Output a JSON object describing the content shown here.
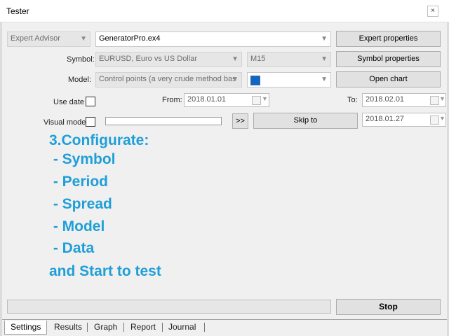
{
  "window": {
    "title": "Tester",
    "close_glyph": "×"
  },
  "expert": {
    "type_value": "Expert Advisor",
    "file_value": "GeneratorPro.ex4",
    "properties_label": "Expert properties"
  },
  "symbol": {
    "label": "Symbol:",
    "value": "EURUSD, Euro vs US Dollar",
    "period_value": "M15",
    "properties_label": "Symbol properties"
  },
  "model": {
    "label": "Model:",
    "value": "Control points (a very crude method bas",
    "spread_value": "",
    "open_chart_label": "Open chart"
  },
  "use_date": {
    "label": "Use date",
    "checked": false,
    "from_label": "From:",
    "from_value": "2018.01.01",
    "to_label": "To:",
    "to_value": "2018.02.01"
  },
  "visual_mode": {
    "label": "Visual mode",
    "checked": false,
    "forward_label": ">>",
    "skip_label": "Skip to",
    "skip_value": "2018.01.27"
  },
  "annotation": {
    "lines": [
      "3.Configurate:",
      " - Symbol",
      " - Period",
      " - Spread",
      " - Model",
      " - Data",
      "and Start to test"
    ],
    "color": "#1f9fd8"
  },
  "actions": {
    "stop_label": "Stop",
    "progress": 0
  },
  "tabs": [
    "Settings",
    "Results",
    "Graph",
    "Report",
    "Journal"
  ],
  "active_tab": "Settings",
  "icons": {
    "close": "close-icon",
    "dropdown": "chevron-down-icon",
    "calendar": "calendar-icon"
  }
}
